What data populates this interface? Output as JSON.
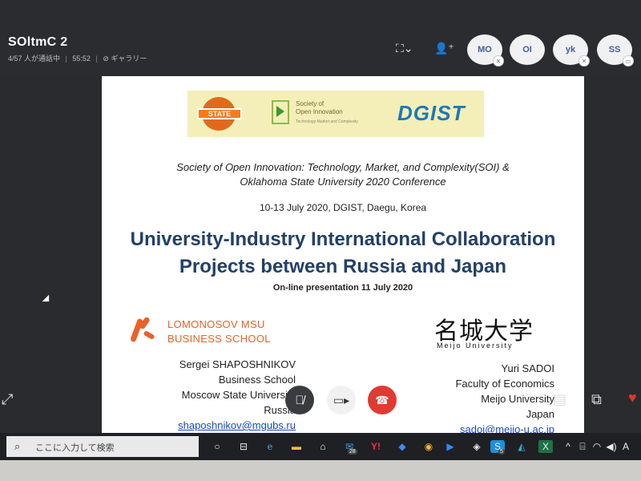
{
  "meeting": {
    "title": "SOltmC 2",
    "participants": "4/57 人が通話中",
    "duration": "55:52",
    "view_mode": "ギャラリー"
  },
  "avatars": [
    "MO",
    "OI",
    "yk",
    "SS"
  ],
  "slide": {
    "logos": {
      "osu": "STATE",
      "soi_line1": "Society of",
      "soi_line2": "Open Innovation",
      "soi_line3": "Technology  Market and Complexity",
      "dgist": "DGIST"
    },
    "conference_line1": "Society of Open Innovation: Technology, Market, and Complexity(SOI) &",
    "conference_line2": "Oklahoma State University 2020 Conference",
    "date_place": "10-13 July  2020, DGIST, Daegu, Korea",
    "heading_line1": "University-Industry International Collaboration",
    "heading_line2": "Projects between Russia and Japan",
    "online": "On-line presentation 11 July 2020",
    "msu_line1": "LOMONOSOV MSU",
    "msu_line2": "BUSINESS SCHOOL",
    "meijo_kanji": "名城大学",
    "meijo_english": "Meijo University",
    "left_person": {
      "name": "Sergei SHAPOSHNIKOV",
      "dept": "Business School",
      "org": "Moscow State University",
      "country": "Russia",
      "email": "shaposhnikov@mgubs.ru"
    },
    "right_person": {
      "name": "Yuri SADOI",
      "dept": "Faculty of Economics",
      "org": "Meijo University",
      "country": "Japan",
      "email": "sadoi@meijo-u.ac.jp"
    }
  },
  "taskbar": {
    "search_placeholder": "ここに入力して検索",
    "mail_badge": "28",
    "skype_badge": "5"
  }
}
